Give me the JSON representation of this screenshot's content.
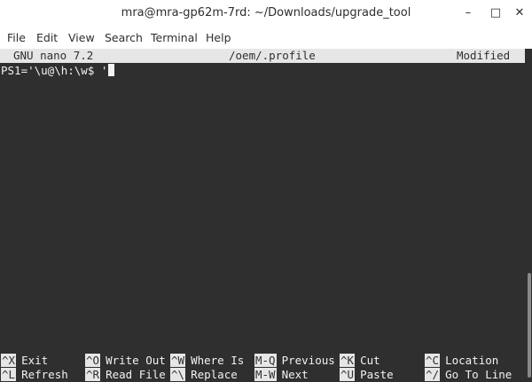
{
  "window": {
    "title": "mra@mra-gp62m-7rd: ~/Downloads/upgrade_tool",
    "minimize": "–",
    "maximize": "□",
    "close": "✕"
  },
  "menubar": {
    "items": [
      "File",
      "Edit",
      "View",
      "Search",
      "Terminal",
      "Help"
    ]
  },
  "nano": {
    "version": "GNU nano 7.2",
    "filename": "/oem/.profile",
    "status": "Modified",
    "content_line": "PS1='\\u@\\h:\\w$ '",
    "shortcuts_row1": [
      {
        "key": "^X",
        "label": "Exit"
      },
      {
        "key": "^O",
        "label": "Write Out"
      },
      {
        "key": "^W",
        "label": "Where Is"
      },
      {
        "key": "M-Q",
        "label": "Previous"
      },
      {
        "key": "^K",
        "label": "Cut"
      },
      {
        "key": "^C",
        "label": "Location"
      }
    ],
    "shortcuts_row2": [
      {
        "key": "^L",
        "label": "Refresh"
      },
      {
        "key": "^R",
        "label": "Read File"
      },
      {
        "key": "^\\",
        "label": "Replace"
      },
      {
        "key": "M-W",
        "label": "Next"
      },
      {
        "key": "^U",
        "label": "Paste"
      },
      {
        "key": "^/",
        "label": "Go To Line"
      }
    ]
  },
  "colors": {
    "terminal_bg": "#2f2f2f",
    "terminal_fg": "#f2f2f2",
    "inverse_bg": "#e6e6e6"
  }
}
